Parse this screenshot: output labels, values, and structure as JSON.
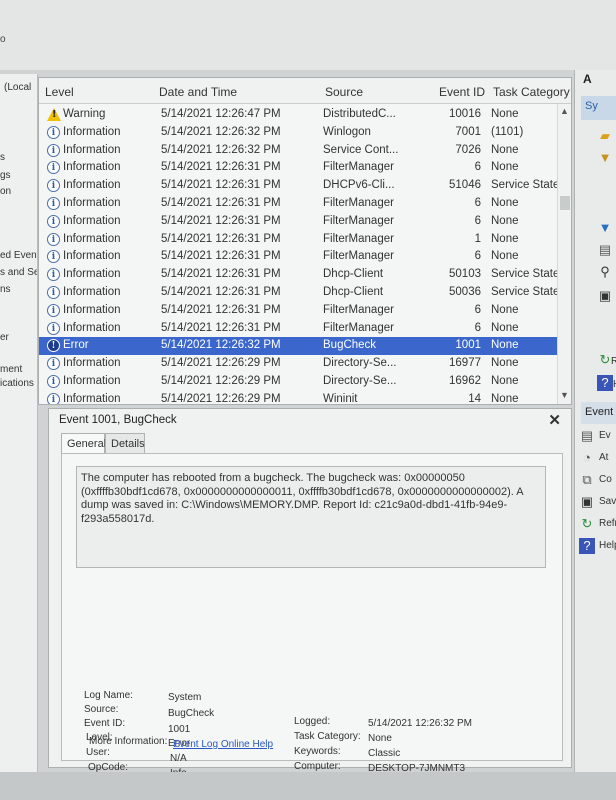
{
  "left_pane": {
    "items": [
      "(Local",
      "s",
      "gs",
      "on",
      "ed Event",
      "s and Se",
      "ns",
      "er",
      "ment",
      "ications"
    ]
  },
  "event_list": {
    "columns": [
      "Level",
      "Date and Time",
      "Source",
      "Event ID",
      "Task Category"
    ],
    "rows": [
      {
        "level": "Warning",
        "date": "5/14/2021 12:26:47 PM",
        "source": "DistributedC...",
        "id": "10016",
        "task": "None"
      },
      {
        "level": "Information",
        "date": "5/14/2021 12:26:32 PM",
        "source": "Winlogon",
        "id": "7001",
        "task": "(1101)"
      },
      {
        "level": "Information",
        "date": "5/14/2021 12:26:32 PM",
        "source": "Service Cont...",
        "id": "7026",
        "task": "None"
      },
      {
        "level": "Information",
        "date": "5/14/2021 12:26:31 PM",
        "source": "FilterManager",
        "id": "6",
        "task": "None"
      },
      {
        "level": "Information",
        "date": "5/14/2021 12:26:31 PM",
        "source": "DHCPv6-Cli...",
        "id": "51046",
        "task": "Service State ..."
      },
      {
        "level": "Information",
        "date": "5/14/2021 12:26:31 PM",
        "source": "FilterManager",
        "id": "6",
        "task": "None"
      },
      {
        "level": "Information",
        "date": "5/14/2021 12:26:31 PM",
        "source": "FilterManager",
        "id": "6",
        "task": "None"
      },
      {
        "level": "Information",
        "date": "5/14/2021 12:26:31 PM",
        "source": "FilterManager",
        "id": "1",
        "task": "None"
      },
      {
        "level": "Information",
        "date": "5/14/2021 12:26:31 PM",
        "source": "FilterManager",
        "id": "6",
        "task": "None"
      },
      {
        "level": "Information",
        "date": "5/14/2021 12:26:31 PM",
        "source": "Dhcp-Client",
        "id": "50103",
        "task": "Service State ..."
      },
      {
        "level": "Information",
        "date": "5/14/2021 12:26:31 PM",
        "source": "Dhcp-Client",
        "id": "50036",
        "task": "Service State ..."
      },
      {
        "level": "Information",
        "date": "5/14/2021 12:26:31 PM",
        "source": "FilterManager",
        "id": "6",
        "task": "None"
      },
      {
        "level": "Information",
        "date": "5/14/2021 12:26:31 PM",
        "source": "FilterManager",
        "id": "6",
        "task": "None"
      },
      {
        "level": "Error",
        "date": "5/14/2021 12:26:32 PM",
        "source": "BugCheck",
        "id": "1001",
        "task": "None",
        "selected": true
      },
      {
        "level": "Information",
        "date": "5/14/2021 12:26:29 PM",
        "source": "Directory-Se...",
        "id": "16977",
        "task": "None"
      },
      {
        "level": "Information",
        "date": "5/14/2021 12:26:29 PM",
        "source": "Directory-Se...",
        "id": "16962",
        "task": "None"
      },
      {
        "level": "Information",
        "date": "5/14/2021 12:26:29 PM",
        "source": "Wininit",
        "id": "14",
        "task": "None"
      }
    ]
  },
  "detail": {
    "title": "Event 1001, BugCheck",
    "close_label": "✕",
    "tabs": [
      "General",
      "Details"
    ],
    "message": "The computer has rebooted from a bugcheck.  The bugcheck was: 0x00000050 (0xffffb30bdf1cd678, 0x0000000000000011, 0xffffb30bdf1cd678, 0x0000000000000002). A dump was saved in: C:\\Windows\\MEMORY.DMP. Report Id: c21c9a0d-dbd1-41fb-94e9-f293a558017d.",
    "props_left": [
      {
        "label": "Log Name:",
        "value": "System"
      },
      {
        "label": "Source:",
        "value": "BugCheck"
      },
      {
        "label": "Event ID:",
        "value": "1001"
      },
      {
        "label": "Level:",
        "value": "Error"
      },
      {
        "label": "User:",
        "value": "N/A"
      },
      {
        "label": "OpCode:",
        "value": "Info"
      }
    ],
    "props_right": [
      {
        "label": "Logged:",
        "value": "5/14/2021 12:26:32 PM"
      },
      {
        "label": "Task Category:",
        "value": "None"
      },
      {
        "label": "Keywords:",
        "value": "Classic"
      },
      {
        "label": "Computer:",
        "value": "DESKTOP-7JMNMT3"
      }
    ],
    "more_info_label": "More Information:",
    "more_info_link": "Event Log Online Help"
  },
  "right_pane": {
    "header": "A",
    "top_items": [
      "Sy",
      "R",
      "H"
    ],
    "event_section_label": "Event",
    "event_items": [
      "Ev",
      "At",
      "Co",
      "Sav",
      "Refr",
      "Help"
    ]
  }
}
